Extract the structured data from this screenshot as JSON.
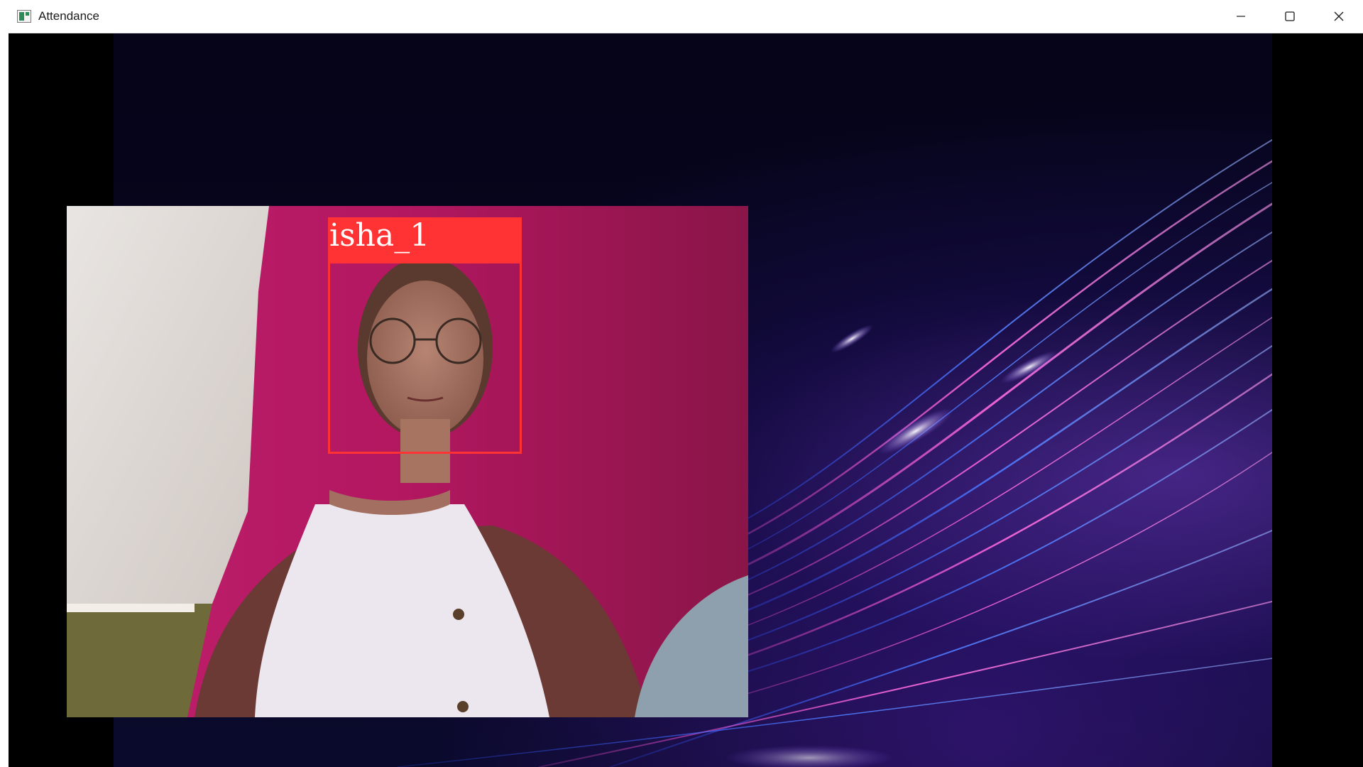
{
  "window": {
    "title": "Attendance",
    "icon": "app-window-icon"
  },
  "controls": {
    "minimize": "minimize-icon",
    "maximize": "maximize-icon",
    "close": "close-icon"
  },
  "recognition": {
    "label": "isha_1",
    "box_color": "#ff3333"
  },
  "colors": {
    "background_accent": "#6a3cc8",
    "streak_pink": "#ff4fd8",
    "streak_blue": "#3a6bff"
  }
}
